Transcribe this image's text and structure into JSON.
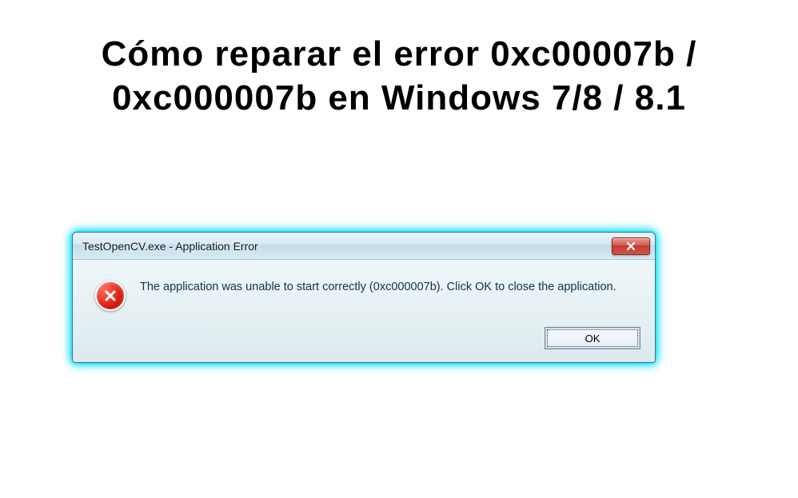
{
  "headline": "Cómo reparar el error 0xc00007b / 0xc000007b en Windows 7/8 / 8.1",
  "dialog": {
    "title": "TestOpenCV.exe - Application Error",
    "message": "The application was unable to start correctly (0xc000007b). Click OK to close the application.",
    "ok_label": "OK"
  },
  "icons": {
    "close": "close-icon",
    "error": "error-icon"
  },
  "colors": {
    "glow": "#00e0f8",
    "close_button": "#c23b31",
    "error_circle": "#d91f10"
  }
}
